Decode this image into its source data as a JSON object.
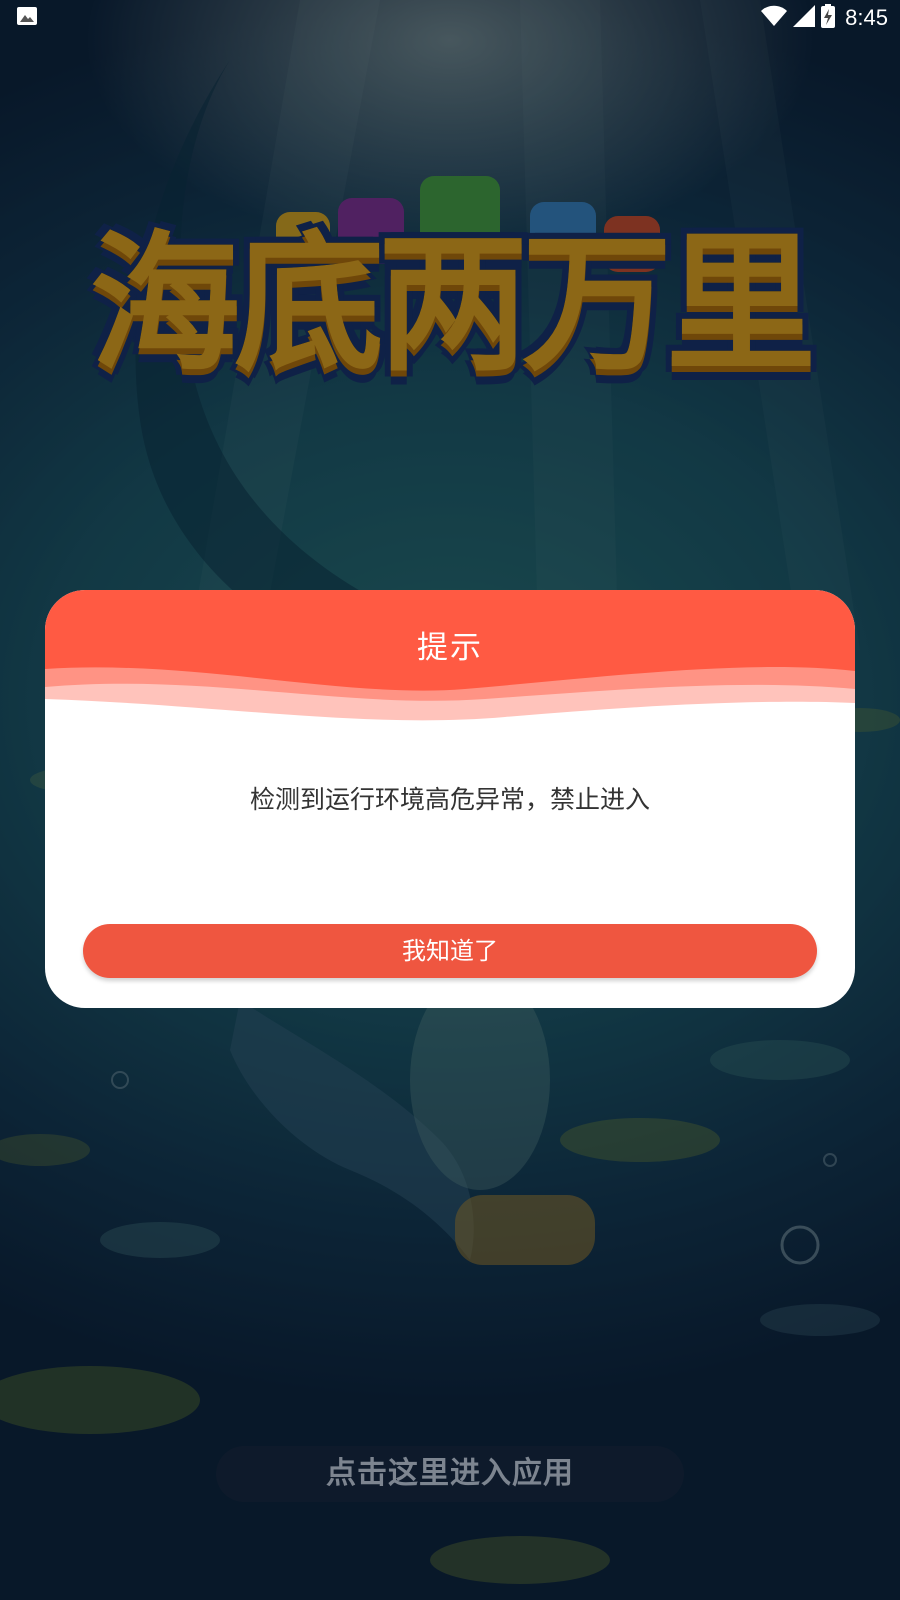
{
  "status_bar": {
    "time": "8:45",
    "icons": [
      "image-notification-icon",
      "wifi-icon",
      "cellular-signal-icon",
      "battery-charging-icon"
    ]
  },
  "game": {
    "title": "海底两万里",
    "enter_button_label": "点击这里进入应用"
  },
  "dialog": {
    "title": "提示",
    "message": "检测到运行环境高危异常，禁止进入",
    "confirm_label": "我知道了"
  },
  "colors": {
    "dialog_header": "#ff5a43",
    "confirm_button": "#ef5640",
    "title_gold": "#f1b127",
    "title_outline": "#1a3a7a"
  }
}
